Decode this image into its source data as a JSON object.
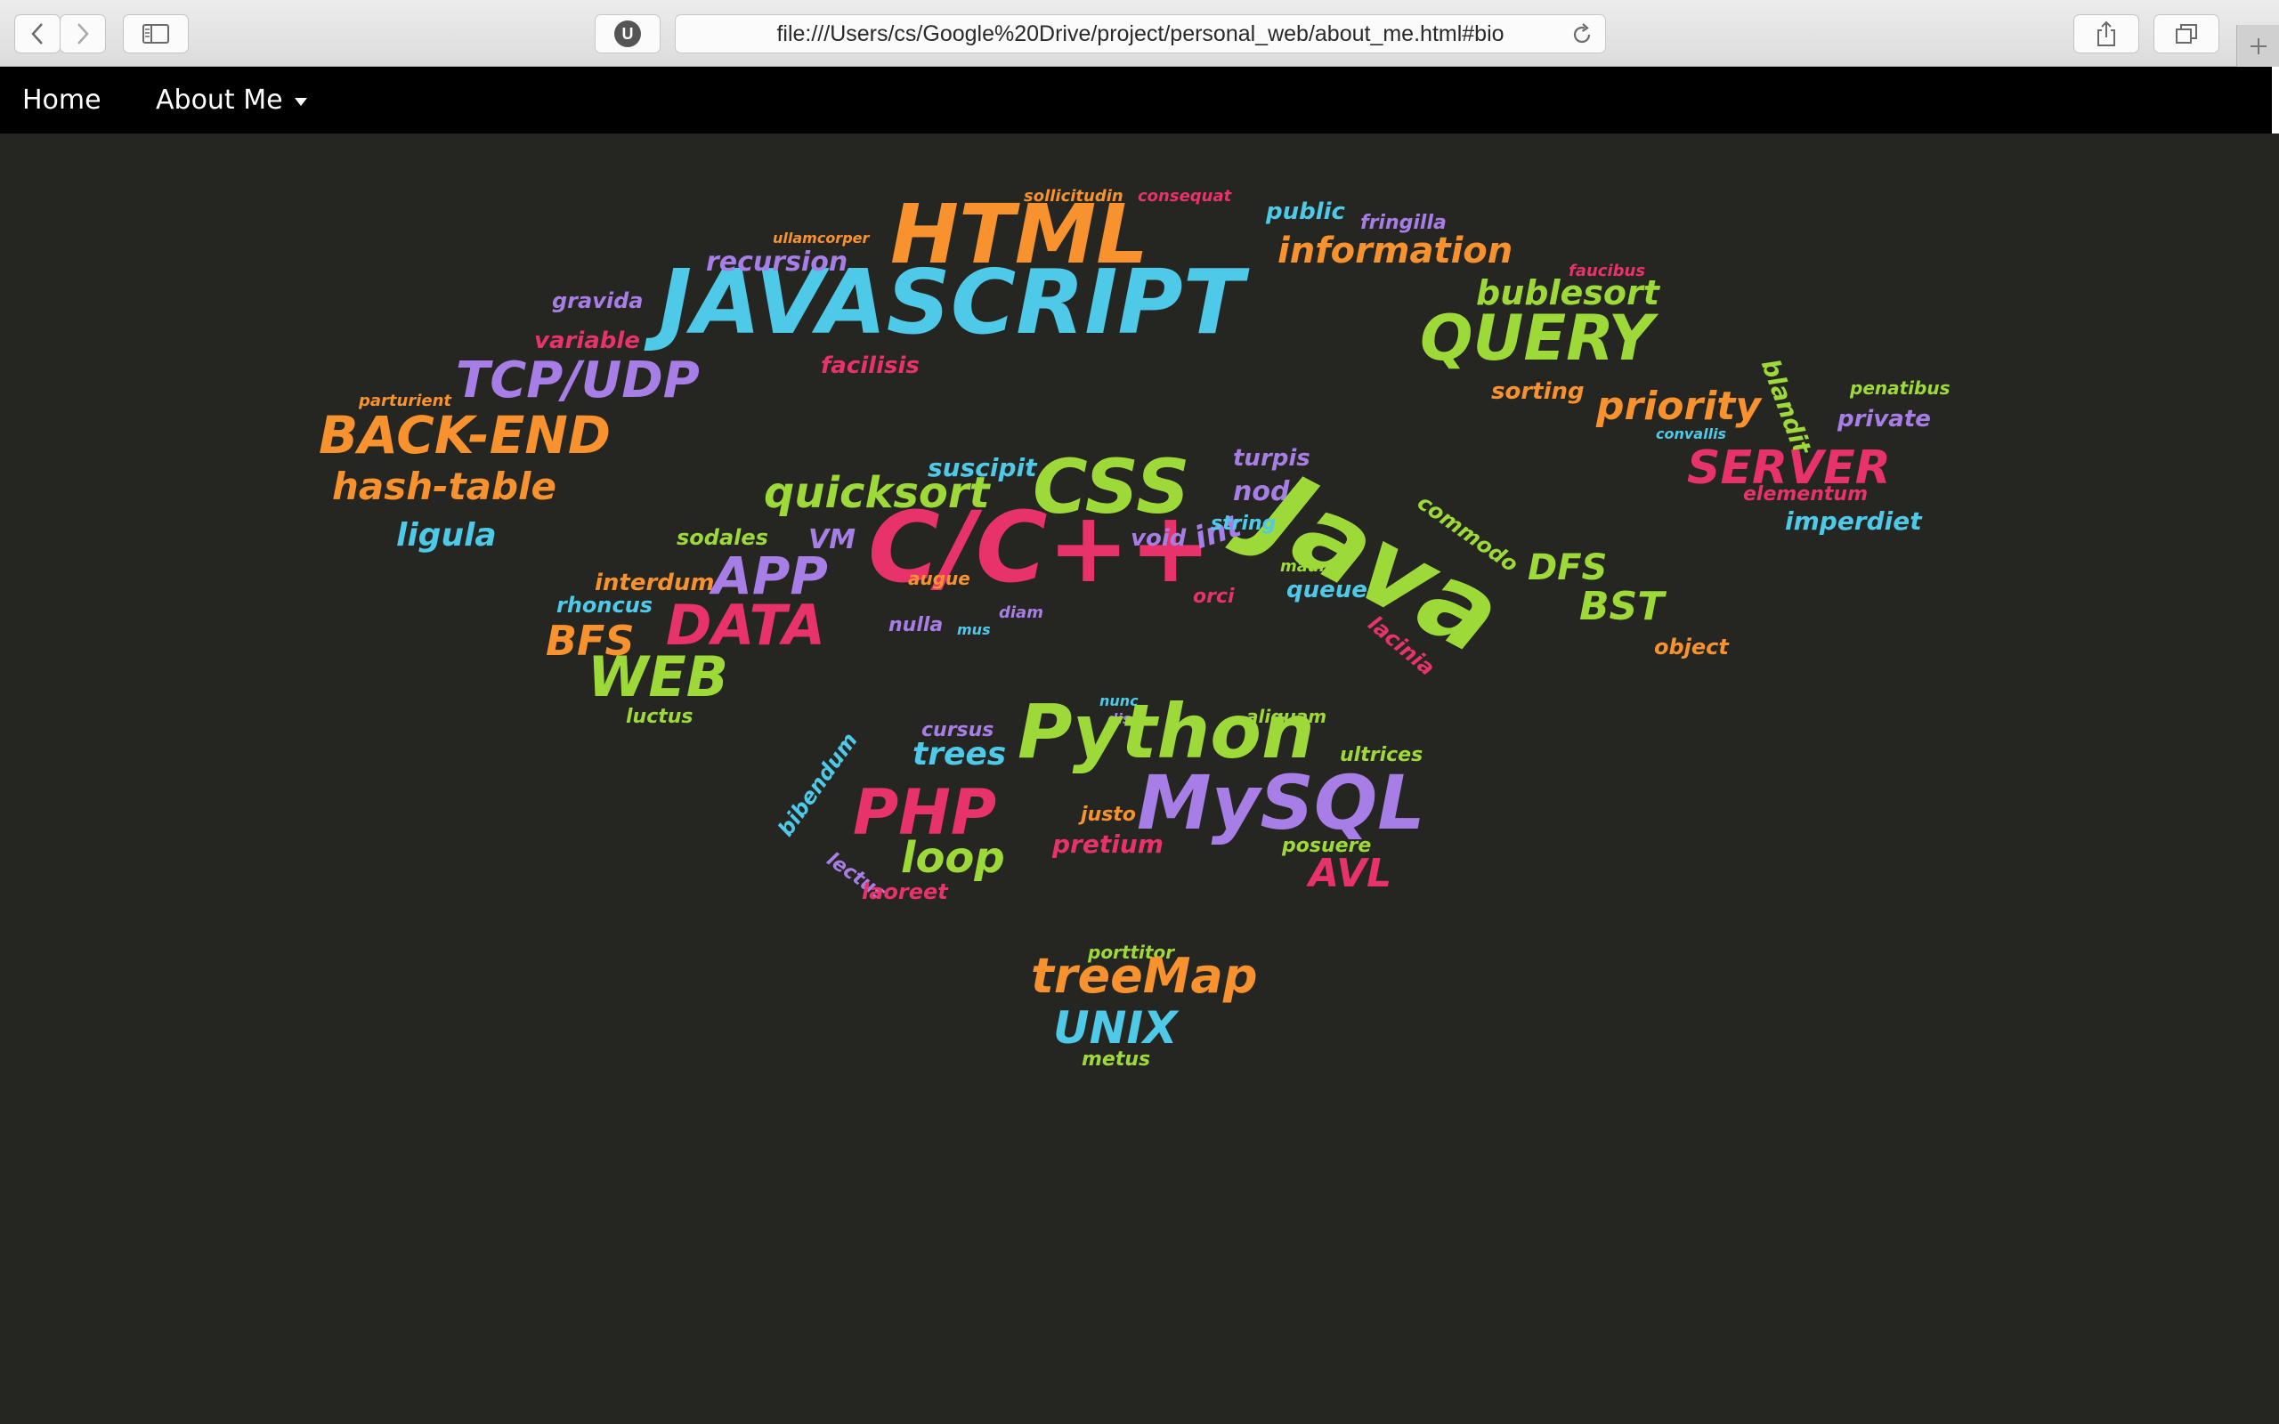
{
  "browser": {
    "url": "file:///Users/cs/Google%20Drive/project/personal_web/about_me.html#bio",
    "extension_badge": "U"
  },
  "nav": {
    "home_label": "Home",
    "about_label": "About Me"
  },
  "wordcloud": {
    "colors": {
      "orange": "#f7922e",
      "cyan": "#4ec9e8",
      "green": "#9ed93a",
      "purple": "#a77de6",
      "pink": "#e8336a"
    },
    "words": [
      {
        "text": "HTML",
        "color": "orange"
      },
      {
        "text": "JAVASCRIPT",
        "color": "cyan"
      },
      {
        "text": "QUERY",
        "color": "green"
      },
      {
        "text": "recursion",
        "color": "purple"
      },
      {
        "text": "information",
        "color": "orange"
      },
      {
        "text": "bublesort",
        "color": "green"
      },
      {
        "text": "public",
        "color": "cyan"
      },
      {
        "text": "fringilla",
        "color": "purple"
      },
      {
        "text": "sollicitudin",
        "color": "orange"
      },
      {
        "text": "consequat",
        "color": "pink"
      },
      {
        "text": "ullamcorper",
        "color": "orange"
      },
      {
        "text": "faucibus",
        "color": "pink"
      },
      {
        "text": "gravida",
        "color": "purple"
      },
      {
        "text": "variable",
        "color": "pink"
      },
      {
        "text": "facilisis",
        "color": "pink"
      },
      {
        "text": "TCP/UDP",
        "color": "purple"
      },
      {
        "text": "parturient",
        "color": "orange"
      },
      {
        "text": "BACK-END",
        "color": "orange"
      },
      {
        "text": "hash-table",
        "color": "orange"
      },
      {
        "text": "ligula",
        "color": "cyan"
      },
      {
        "text": "sorting",
        "color": "orange"
      },
      {
        "text": "priority",
        "color": "orange"
      },
      {
        "text": "blandit",
        "color": "green"
      },
      {
        "text": "penatibus",
        "color": "green"
      },
      {
        "text": "private",
        "color": "purple"
      },
      {
        "text": "convallis",
        "color": "cyan"
      },
      {
        "text": "SERVER",
        "color": "pink"
      },
      {
        "text": "elementum",
        "color": "pink"
      },
      {
        "text": "imperdiet",
        "color": "cyan"
      },
      {
        "text": "CSS",
        "color": "green"
      },
      {
        "text": "suscipit",
        "color": "cyan"
      },
      {
        "text": "turpis",
        "color": "purple"
      },
      {
        "text": "quicksort",
        "color": "green"
      },
      {
        "text": "node",
        "color": "purple"
      },
      {
        "text": "commodo",
        "color": "green"
      },
      {
        "text": "Java",
        "color": "green"
      },
      {
        "text": "sodales",
        "color": "green"
      },
      {
        "text": "VM",
        "color": "purple"
      },
      {
        "text": "C/C++",
        "color": "pink"
      },
      {
        "text": "void",
        "color": "purple"
      },
      {
        "text": "int",
        "color": "purple"
      },
      {
        "text": "string",
        "color": "cyan"
      },
      {
        "text": "APP",
        "color": "purple"
      },
      {
        "text": "interdum",
        "color": "orange"
      },
      {
        "text": "rhoncus",
        "color": "cyan"
      },
      {
        "text": "DATA",
        "color": "pink"
      },
      {
        "text": "BFS",
        "color": "orange"
      },
      {
        "text": "augue",
        "color": "orange"
      },
      {
        "text": "nulla",
        "color": "purple"
      },
      {
        "text": "mus",
        "color": "cyan"
      },
      {
        "text": "diam",
        "color": "purple"
      },
      {
        "text": "orci",
        "color": "pink"
      },
      {
        "text": "queue",
        "color": "cyan"
      },
      {
        "text": "mauris",
        "color": "green"
      },
      {
        "text": "DFS",
        "color": "green"
      },
      {
        "text": "BST",
        "color": "green"
      },
      {
        "text": "lacinia",
        "color": "pink"
      },
      {
        "text": "object",
        "color": "orange"
      },
      {
        "text": "WEB",
        "color": "green"
      },
      {
        "text": "luctus",
        "color": "green"
      },
      {
        "text": "nunc",
        "color": "cyan"
      },
      {
        "text": "dis",
        "color": "purple"
      },
      {
        "text": "aliquam",
        "color": "green"
      },
      {
        "text": "cursus",
        "color": "purple"
      },
      {
        "text": "trees",
        "color": "cyan"
      },
      {
        "text": "Python",
        "color": "green"
      },
      {
        "text": "ultrices",
        "color": "green"
      },
      {
        "text": "bibendum",
        "color": "cyan"
      },
      {
        "text": "PHP",
        "color": "pink"
      },
      {
        "text": "justo",
        "color": "orange"
      },
      {
        "text": "MySQL",
        "color": "purple"
      },
      {
        "text": "pretium",
        "color": "pink"
      },
      {
        "text": "posuere",
        "color": "green"
      },
      {
        "text": "loop",
        "color": "green"
      },
      {
        "text": "lectus",
        "color": "purple"
      },
      {
        "text": "laoreet",
        "color": "pink"
      },
      {
        "text": "AVL",
        "color": "pink"
      },
      {
        "text": "porttitor",
        "color": "green"
      },
      {
        "text": "treeMap",
        "color": "orange"
      },
      {
        "text": "UNIX",
        "color": "cyan"
      },
      {
        "text": "metus",
        "color": "green"
      }
    ]
  }
}
